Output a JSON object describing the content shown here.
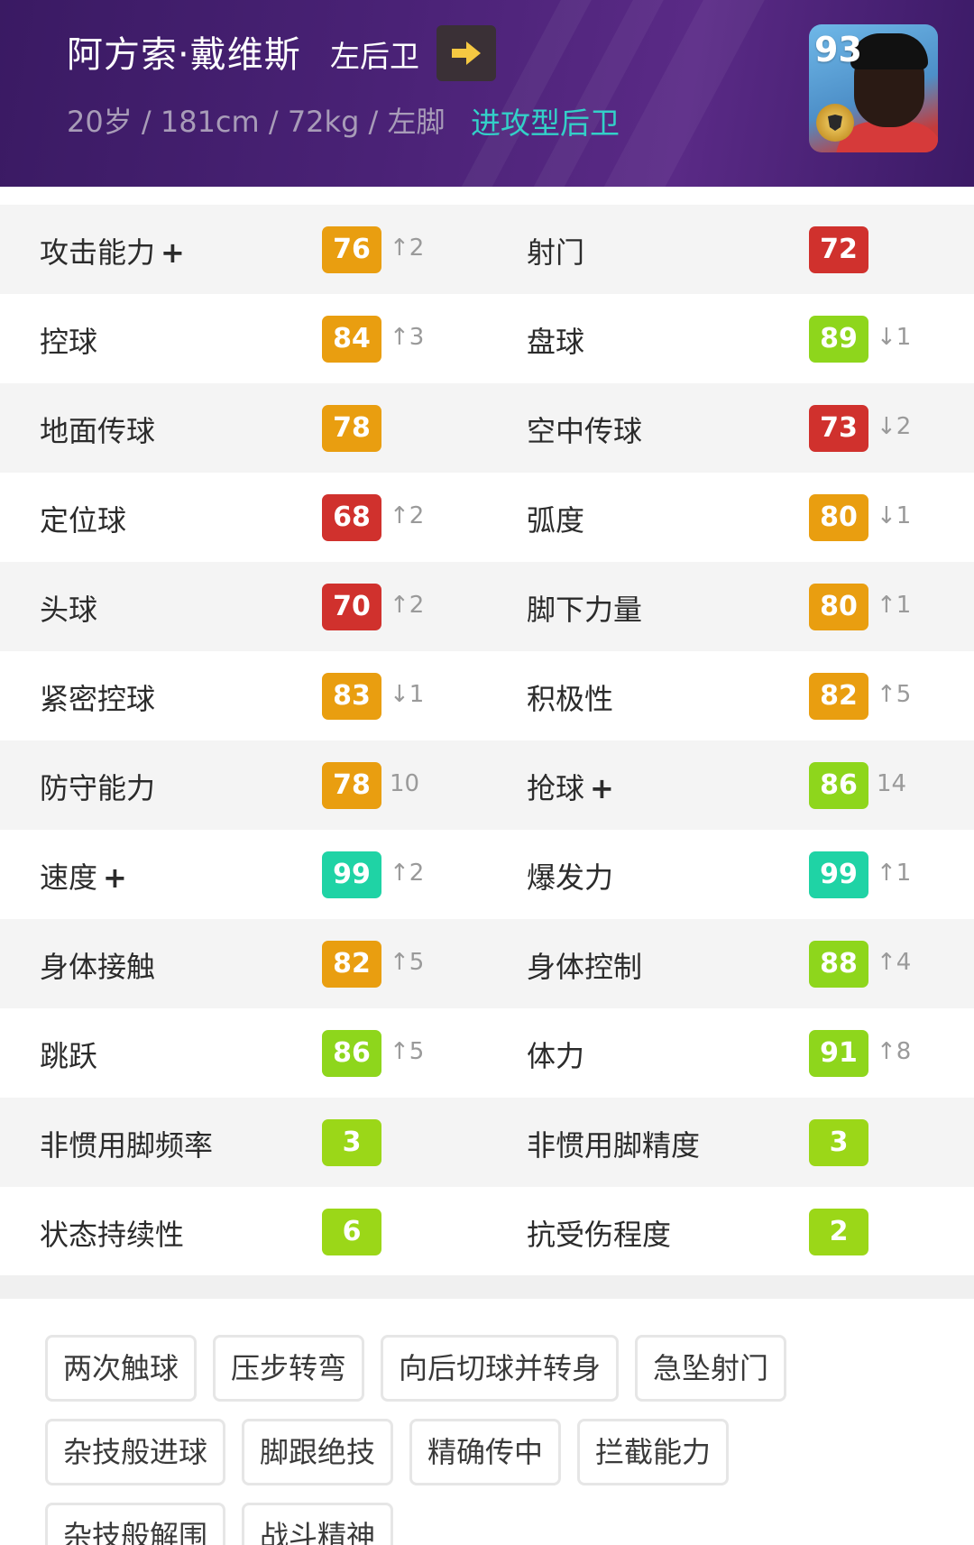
{
  "header": {
    "name": "阿方索·戴维斯",
    "position": "左后卫",
    "bio": "20岁 / 181cm / 72kg / 左脚",
    "playstyle": "进攻型后卫",
    "overall": "93",
    "colors": {
      "background": "#4a2276",
      "playstyle": "#33d0c8"
    }
  },
  "stats": [
    {
      "left": {
        "label": "攻击能力",
        "plus": "+",
        "value": "76",
        "delta": "↑2",
        "color": "orange"
      },
      "right": {
        "label": "射门",
        "plus": "",
        "value": "72",
        "delta": "",
        "color": "red"
      }
    },
    {
      "left": {
        "label": "控球",
        "plus": "",
        "value": "84",
        "delta": "↑3",
        "color": "orange"
      },
      "right": {
        "label": "盘球",
        "plus": "",
        "value": "89",
        "delta": "↓1",
        "color": "lime"
      }
    },
    {
      "left": {
        "label": "地面传球",
        "plus": "",
        "value": "78",
        "delta": "",
        "color": "orange"
      },
      "right": {
        "label": "空中传球",
        "plus": "",
        "value": "73",
        "delta": "↓2",
        "color": "red"
      }
    },
    {
      "left": {
        "label": "定位球",
        "plus": "",
        "value": "68",
        "delta": "↑2",
        "color": "red"
      },
      "right": {
        "label": "弧度",
        "plus": "",
        "value": "80",
        "delta": "↓1",
        "color": "orange"
      }
    },
    {
      "left": {
        "label": "头球",
        "plus": "",
        "value": "70",
        "delta": "↑2",
        "color": "red"
      },
      "right": {
        "label": "脚下力量",
        "plus": "",
        "value": "80",
        "delta": "↑1",
        "color": "orange"
      }
    },
    {
      "left": {
        "label": "紧密控球",
        "plus": "",
        "value": "83",
        "delta": "↓1",
        "color": "orange"
      },
      "right": {
        "label": "积极性",
        "plus": "",
        "value": "82",
        "delta": "↑5",
        "color": "orange"
      }
    },
    {
      "left": {
        "label": "防守能力",
        "plus": "",
        "value": "78",
        "delta": "10",
        "color": "orange"
      },
      "right": {
        "label": "抢球",
        "plus": "+",
        "value": "86",
        "delta": "14",
        "color": "lime"
      }
    },
    {
      "left": {
        "label": "速度",
        "plus": "+",
        "value": "99",
        "delta": "↑2",
        "color": "teal"
      },
      "right": {
        "label": "爆发力",
        "plus": "",
        "value": "99",
        "delta": "↑1",
        "color": "teal"
      }
    },
    {
      "left": {
        "label": "身体接触",
        "plus": "",
        "value": "82",
        "delta": "↑5",
        "color": "orange"
      },
      "right": {
        "label": "身体控制",
        "plus": "",
        "value": "88",
        "delta": "↑4",
        "color": "lime"
      }
    },
    {
      "left": {
        "label": "跳跃",
        "plus": "",
        "value": "86",
        "delta": "↑5",
        "color": "lime"
      },
      "right": {
        "label": "体力",
        "plus": "",
        "value": "91",
        "delta": "↑8",
        "color": "lime"
      }
    },
    {
      "left": {
        "label": "非惯用脚频率",
        "plus": "",
        "value": "3",
        "delta": "",
        "color": "green"
      },
      "right": {
        "label": "非惯用脚精度",
        "plus": "",
        "value": "3",
        "delta": "",
        "color": "green"
      }
    },
    {
      "left": {
        "label": "状态持续性",
        "plus": "",
        "value": "6",
        "delta": "",
        "color": "green"
      },
      "right": {
        "label": "抗受伤程度",
        "plus": "",
        "value": "2",
        "delta": "",
        "color": "green"
      }
    }
  ],
  "skills": [
    [
      "两次触球",
      "压步转弯",
      "向后切球并转身",
      "急坠射门"
    ],
    [
      "杂技般进球",
      "脚跟绝技",
      "精确传中",
      "拦截能力"
    ],
    [
      "杂技般解围",
      "战斗精神"
    ]
  ],
  "icons": {
    "arrow": "arrow-right-icon",
    "badge": "league-badge-icon"
  },
  "colors": {
    "red": "#d0312d",
    "orange": "#e99e10",
    "lime": "#8ed61c",
    "green": "#9bd718",
    "teal": "#1fd3a5"
  }
}
